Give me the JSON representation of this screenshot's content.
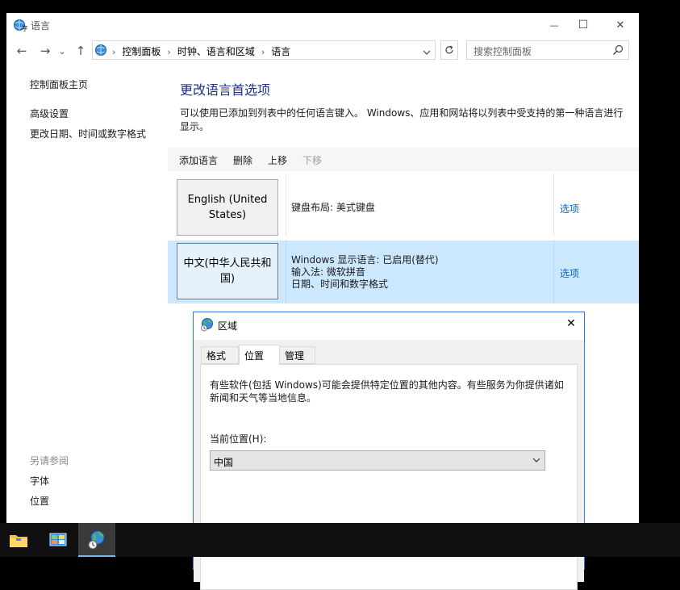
{
  "window": {
    "title": "语言",
    "minimize": "—",
    "maximize": "☐",
    "close": "✕"
  },
  "nav": {
    "back": "←",
    "forward": "→",
    "recent": "⌄",
    "up": "↑",
    "breadcrumbs": [
      "控制面板",
      "时钟、语言和区域",
      "语言"
    ],
    "breadcrumb_sep": "›",
    "search_placeholder": "搜索控制面板"
  },
  "left_pane": {
    "home": "控制面板主页",
    "links": [
      "高级设置",
      "更改日期、时间或数字格式"
    ],
    "see_also_title": "另请参阅",
    "see_also": [
      "字体",
      "位置"
    ]
  },
  "content": {
    "heading": "更改语言首选项",
    "description": "可以使用已添加到列表中的任何语言键入。 Windows、应用和网站将以列表中受支持的第一种语言进行显示。",
    "toolbar": {
      "add": "添加语言",
      "remove": "删除",
      "up": "上移",
      "down": "下移"
    },
    "languages": [
      {
        "name": "English (United States)",
        "info": [
          "键盘布局: 美式键盘"
        ],
        "options": "选项",
        "selected": false
      },
      {
        "name": "中文(中华人民共和国)",
        "info": [
          "Windows 显示语言: 已启用(替代)",
          "输入法: 微软拼音",
          "日期、时间和数字格式"
        ],
        "options": "选项",
        "selected": true
      }
    ]
  },
  "region_dialog": {
    "title": "区域",
    "close": "✕",
    "tabs": [
      "格式",
      "位置",
      "管理"
    ],
    "active_tab": "位置",
    "description": "有些软件(包括 Windows)可能会提供特定位置的其他内容。有些服务为你提供诸如新闻和天气等当地信息。",
    "location_label": "当前位置(H):",
    "location_value": "中国"
  },
  "taskbar": {
    "apps": [
      "file-explorer-icon",
      "control-panel-icon",
      "region-settings-icon"
    ],
    "active_index": 2
  },
  "colors": {
    "link": "#0066cc",
    "heading": "#1e3287",
    "selection": "#cce8ff",
    "dialog_border": "#2b79d6"
  }
}
